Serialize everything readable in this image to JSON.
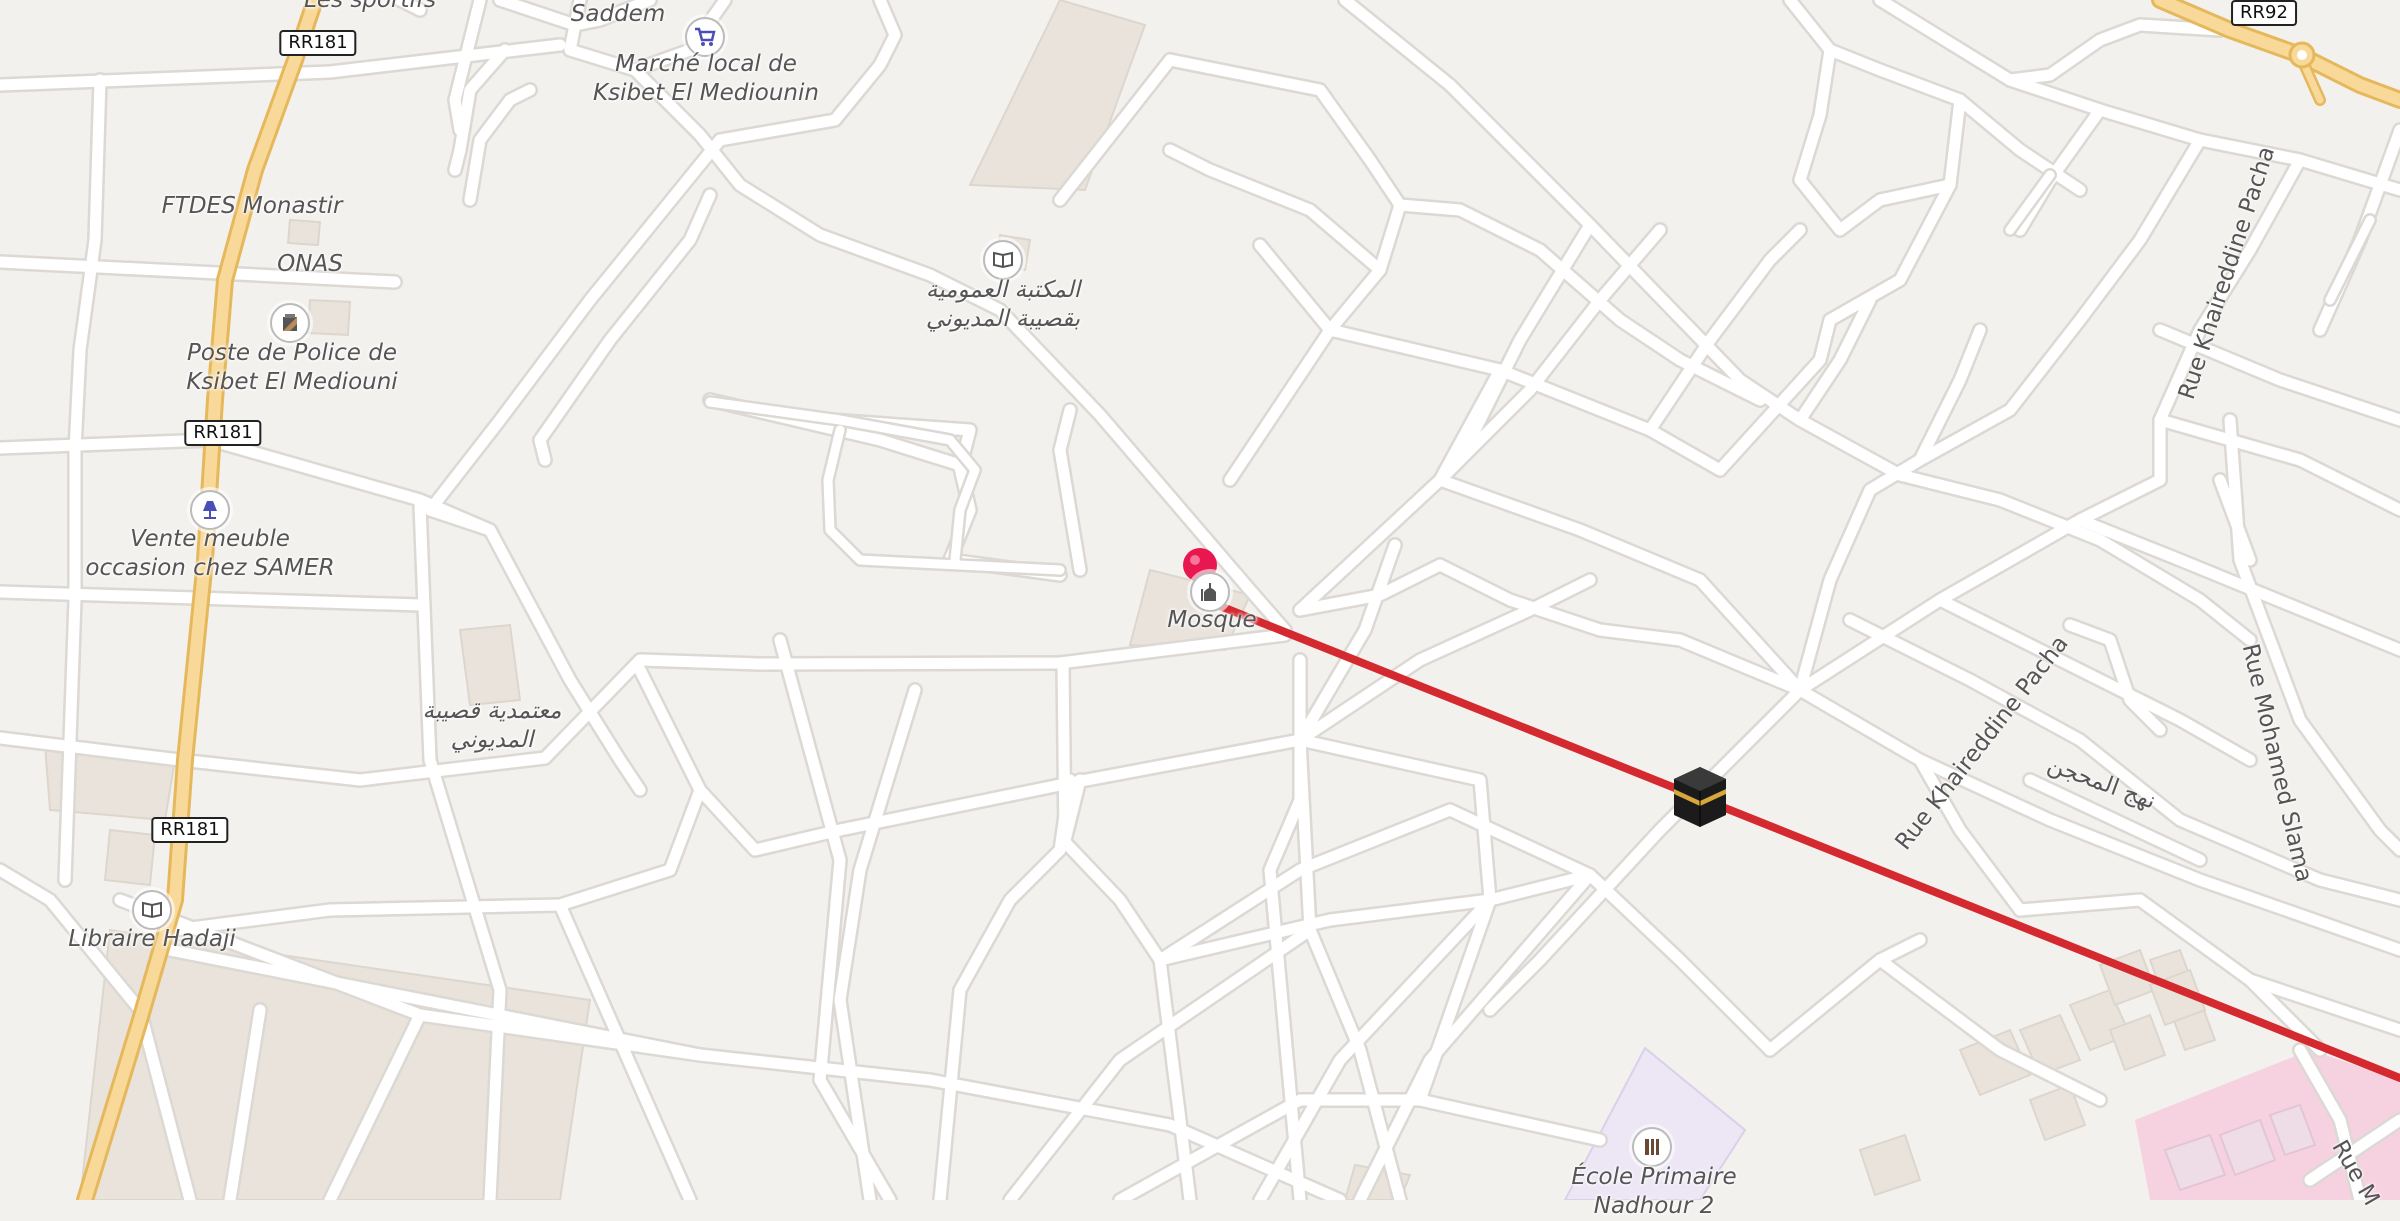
{
  "map": {
    "labels": {
      "les_sportifs": "Les sportifs",
      "saddem": "Saddem",
      "marche": "Marché local de\nKsibet El Mediounin",
      "ftdes": "FTDES Monastir",
      "onas": "ONAS",
      "police": "Poste de Police de\nKsibet El Mediouni",
      "vente": "Vente meuble\noccasion chez SAMER",
      "bibliotheque": "المكتبة العمومية\nبقصيبة المديوني",
      "mosque": "Mosque",
      "moatamdia": "معتمدية قصيبة\nالمديوني",
      "libraire": "Libraire Hadaji",
      "ecole": "École Primaire\nNadhour 2",
      "arabic_street": "نهج المحجن"
    },
    "streets": {
      "khaireddine_upper": "Rue Khaireddine Pacha",
      "khaireddine_lower": "Rue Khaireddine Pacha",
      "mohamed_slama": "Rue Mohamed Slama",
      "edge": "Rue M"
    },
    "shields": {
      "rr181_top": "RR181",
      "rr181_mid": "RR181",
      "rr181_low": "RR181",
      "rr92": "RR92"
    },
    "icons": {
      "shop": "shopping-cart-icon",
      "library": "book-icon",
      "police": "police-icon",
      "furniture": "lamp-icon",
      "mosque": "mosque-icon",
      "bookstore": "book-icon",
      "school": "school-icon",
      "qibla": "kaaba-icon",
      "pin": "map-pin-icon"
    },
    "colors": {
      "background": "#f3f1ee",
      "road": "#ffffff",
      "road_casing": "#dcd8d3",
      "main_road": "#f8d99a",
      "main_road_casing": "#e6b85c",
      "building": "#e9e3dc",
      "route_line": "#d42a2f",
      "pin": "#e8174f",
      "school_area": "#ece6f5",
      "pink_area": "#f6d2e1"
    }
  }
}
